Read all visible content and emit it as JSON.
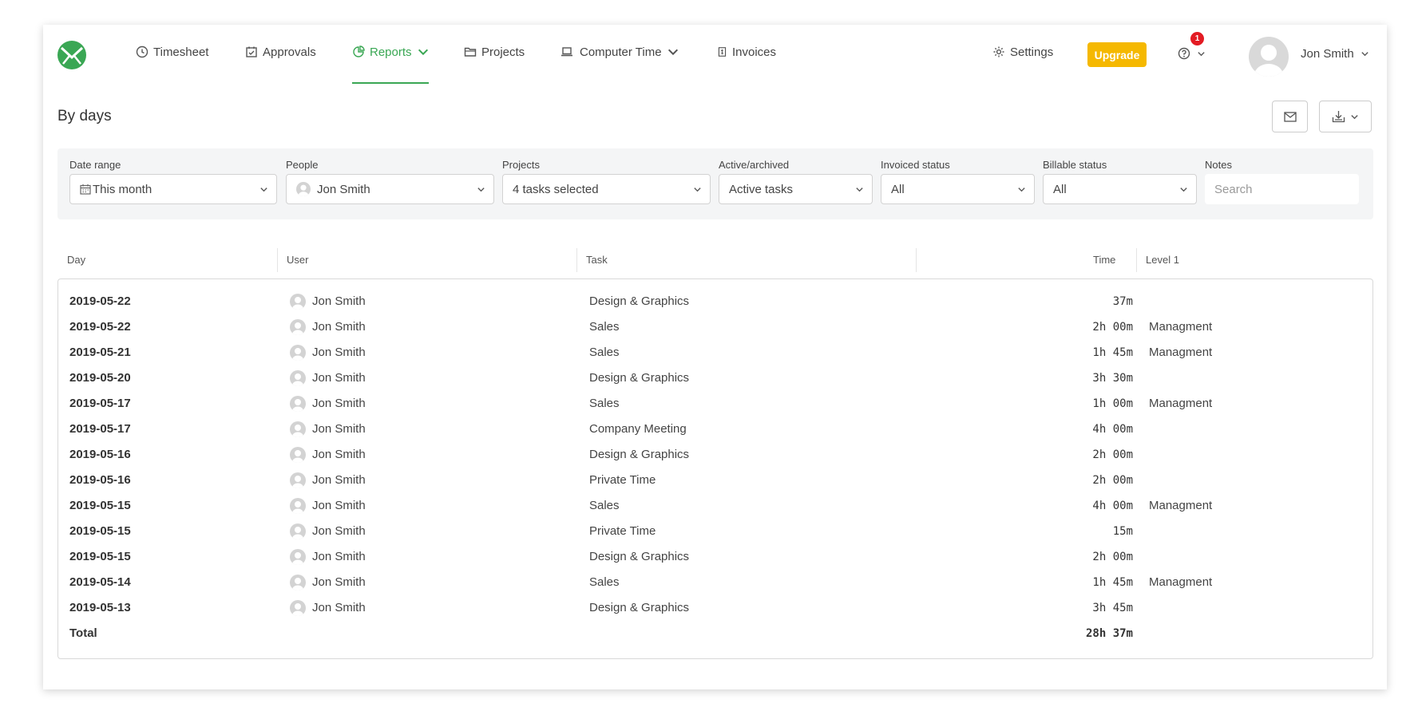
{
  "nav": {
    "items": [
      {
        "label": "Timesheet",
        "icon": "clock-icon"
      },
      {
        "label": "Approvals",
        "icon": "calendar-check-icon"
      },
      {
        "label": "Reports",
        "icon": "pie-chart-icon",
        "active": true
      },
      {
        "label": "Projects",
        "icon": "folder-icon"
      },
      {
        "label": "Computer Time",
        "icon": "laptop-icon"
      },
      {
        "label": "Invoices",
        "icon": "invoice-icon"
      }
    ],
    "settings_label": "Settings",
    "upgrade_label": "Upgrade",
    "notification_count": "1",
    "user_name": "Jon Smith"
  },
  "page": {
    "title": "By days"
  },
  "filters": {
    "date_range": {
      "label": "Date range",
      "value": "This month"
    },
    "people": {
      "label": "People",
      "value": "Jon Smith"
    },
    "projects": {
      "label": "Projects",
      "value": "4 tasks selected"
    },
    "active_archived": {
      "label": "Active/archived",
      "value": "Active tasks"
    },
    "invoiced_status": {
      "label": "Invoiced status",
      "value": "All"
    },
    "billable_status": {
      "label": "Billable status",
      "value": "All"
    },
    "notes": {
      "label": "Notes",
      "placeholder": "Search"
    }
  },
  "table": {
    "headers": {
      "day": "Day",
      "user": "User",
      "task": "Task",
      "time": "Time",
      "level": "Level 1"
    },
    "rows": [
      {
        "day": "2019-05-22",
        "user": "Jon Smith",
        "task": "Design & Graphics",
        "time": "37m",
        "level": ""
      },
      {
        "day": "2019-05-22",
        "user": "Jon Smith",
        "task": "Sales",
        "time": "2h 00m",
        "level": "Managment"
      },
      {
        "day": "2019-05-21",
        "user": "Jon Smith",
        "task": "Sales",
        "time": "1h 45m",
        "level": "Managment"
      },
      {
        "day": "2019-05-20",
        "user": "Jon Smith",
        "task": "Design & Graphics",
        "time": "3h 30m",
        "level": ""
      },
      {
        "day": "2019-05-17",
        "user": "Jon Smith",
        "task": "Sales",
        "time": "1h 00m",
        "level": "Managment"
      },
      {
        "day": "2019-05-17",
        "user": "Jon Smith",
        "task": "Company Meeting",
        "time": "4h 00m",
        "level": ""
      },
      {
        "day": "2019-05-16",
        "user": "Jon Smith",
        "task": "Design & Graphics",
        "time": "2h 00m",
        "level": ""
      },
      {
        "day": "2019-05-16",
        "user": "Jon Smith",
        "task": "Private Time",
        "time": "2h 00m",
        "level": ""
      },
      {
        "day": "2019-05-15",
        "user": "Jon Smith",
        "task": "Sales",
        "time": "4h 00m",
        "level": "Managment"
      },
      {
        "day": "2019-05-15",
        "user": "Jon Smith",
        "task": "Private Time",
        "time": "15m",
        "level": ""
      },
      {
        "day": "2019-05-15",
        "user": "Jon Smith",
        "task": "Design & Graphics",
        "time": "2h 00m",
        "level": ""
      },
      {
        "day": "2019-05-14",
        "user": "Jon Smith",
        "task": "Sales",
        "time": "1h 45m",
        "level": "Managment"
      },
      {
        "day": "2019-05-13",
        "user": "Jon Smith",
        "task": "Design & Graphics",
        "time": "3h 45m",
        "level": ""
      }
    ],
    "total": {
      "label": "Total",
      "time": "28h 37m"
    }
  },
  "colors": {
    "accent": "#3aa754",
    "upgrade": "#f5b800",
    "badge": "#e31b23"
  }
}
